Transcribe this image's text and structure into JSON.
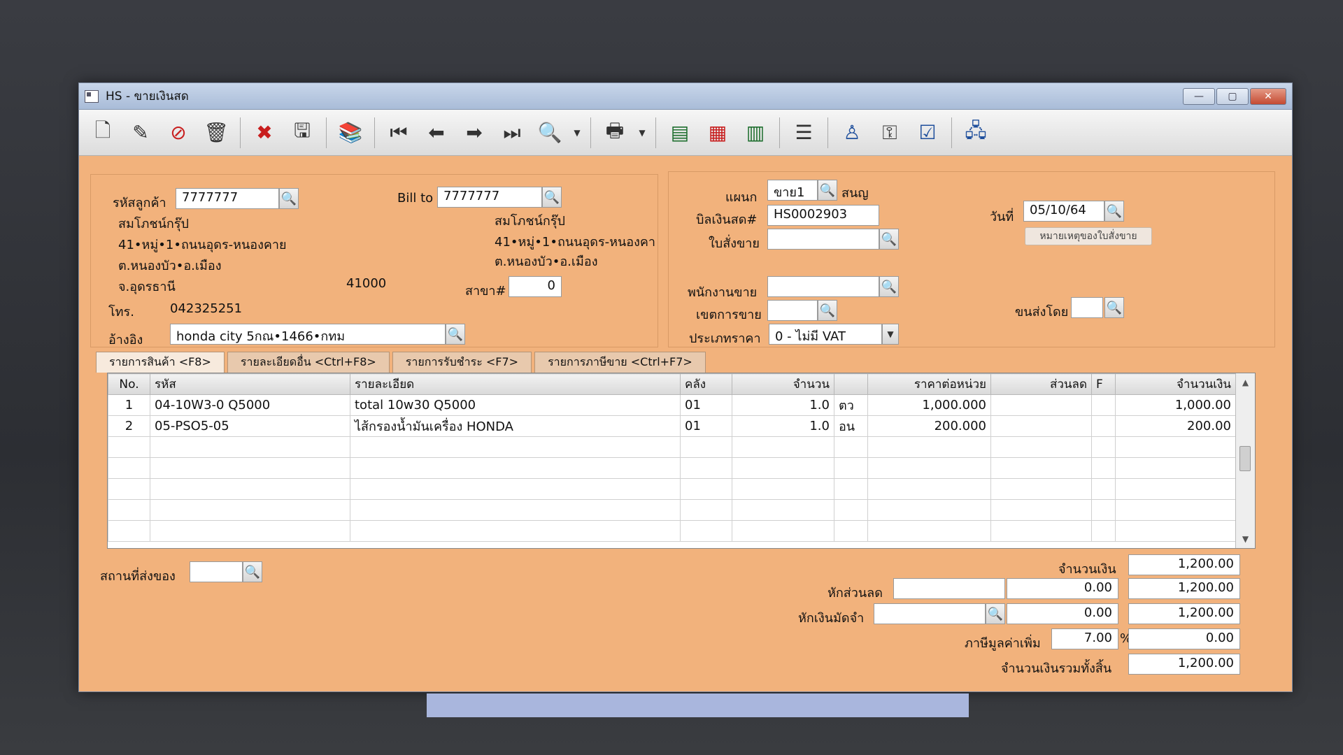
{
  "window": {
    "title": "HS - ขายเงินสด",
    "minimize": "—",
    "maximize": "▢",
    "close": "✕"
  },
  "toolbar": [
    {
      "name": "new-document-icon",
      "glyph": "🗋"
    },
    {
      "name": "edit-icon",
      "glyph": "✎"
    },
    {
      "name": "void-icon",
      "glyph": "⊘"
    },
    {
      "name": "trash-icon",
      "glyph": "🗑"
    },
    {
      "name": "cancel-icon",
      "glyph": "✖"
    },
    {
      "name": "save-icon",
      "glyph": "🖫"
    },
    {
      "name": "books-icon",
      "glyph": "📚"
    },
    {
      "name": "first-record-icon",
      "glyph": "⏮"
    },
    {
      "name": "prev-record-icon",
      "glyph": "⬅"
    },
    {
      "name": "next-record-icon",
      "glyph": "➡"
    },
    {
      "name": "last-record-icon",
      "glyph": "⏭"
    },
    {
      "name": "search-document-icon",
      "glyph": "🔍"
    },
    {
      "name": "print-icon",
      "glyph": "🖶"
    },
    {
      "name": "report-icon",
      "glyph": "▤"
    },
    {
      "name": "form-icon",
      "glyph": "▦"
    },
    {
      "name": "calculator-icon",
      "glyph": "▥"
    },
    {
      "name": "receipt-icon",
      "glyph": "☰"
    },
    {
      "name": "approve-user-icon",
      "glyph": "♙"
    },
    {
      "name": "approve-key-icon",
      "glyph": "⚿"
    },
    {
      "name": "approve-doc-icon",
      "glyph": "☑"
    },
    {
      "name": "network-icon",
      "glyph": "🖧"
    }
  ],
  "customer": {
    "code_label": "รหัสลูกค้า",
    "code": "7777777",
    "name": "สมโภชน์กรุ๊ป",
    "address1": "41•หมู่•1•ถนนอุดร-หนองคาย",
    "address2": "ต.หนองบัว•อ.เมือง",
    "province": "จ.อุดรธานี",
    "postcode": "41000",
    "phone_label": "โทร.",
    "phone": "042325251",
    "ref_label": "อ้างอิง",
    "ref": "honda city 5กณ•1466•กทม"
  },
  "bill_to": {
    "label": "Bill to",
    "code": "7777777",
    "name": "สมโภชน์กรุ๊ป",
    "address1": "41•หมู่•1•ถนนอุดร-หนองคา",
    "address2": "ต.หนองบัว•อ.เมือง",
    "branch_label": "สาขา#",
    "branch": "0"
  },
  "doc": {
    "dept_label": "แผนก",
    "dept": "ขาย1",
    "dept_name": "สนญ",
    "bill_label": "บิลเงินสด#",
    "bill_no": "HS0002903",
    "order_label": "ใบสั่งขาย",
    "order_no": "",
    "date_label": "วันที่",
    "date": "05/10/64",
    "note_button": "หมายเหตุของใบสั่งขาย",
    "salesman_label": "พนักงานขาย",
    "salesman": "",
    "area_label": "เขตการขาย",
    "area": "",
    "ship_label": "ขนส่งโดย",
    "ship": "",
    "price_type_label": "ประเภทราคา",
    "price_type": "0 - ไม่มี VAT"
  },
  "tabs": [
    {
      "label": "รายการสินค้า <F8>"
    },
    {
      "label": "รายละเอียดอื่น <Ctrl+F8>"
    },
    {
      "label": "รายการรับชำระ <F7>"
    },
    {
      "label": "รายการภาษีขาย <Ctrl+F7>"
    }
  ],
  "table": {
    "headers": {
      "no": "No.",
      "code": "รหัส",
      "desc": "รายละเอียด",
      "wh": "คลัง",
      "qty": "จำนวน",
      "unit": "",
      "price": "ราคาต่อหน่วย",
      "disc": "ส่วนลด",
      "f": "F",
      "amount": "จำนวนเงิน"
    },
    "rows": [
      {
        "no": "1",
        "code": "04-10W3-0 Q5000",
        "desc": "total 10w30 Q5000",
        "wh": "01",
        "qty": "1.0",
        "unit": "ตว",
        "price": "1,000.000",
        "disc": "",
        "f": "",
        "amount": "1,000.00"
      },
      {
        "no": "2",
        "code": "05-PSO5-05",
        "desc": "ไส้กรองน้ำมันเครื่อง HONDA",
        "wh": "01",
        "qty": "1.0",
        "unit": "อน",
        "price": "200.000",
        "disc": "",
        "f": "",
        "amount": "200.00"
      }
    ]
  },
  "footer": {
    "ship_place_label": "สถานที่ส่งของ",
    "ship_place": "",
    "amount_label": "จำนวนเงิน",
    "amount": "1,200.00",
    "discount_label": "หักส่วนลด",
    "discount_text": "",
    "discount_value": "0.00",
    "after_discount": "1,200.00",
    "deposit_label": "หักเงินมัดจำ",
    "deposit_text": "",
    "deposit_value": "0.00",
    "after_deposit": "1,200.00",
    "vat_label": "ภาษีมูลค่าเพิ่ม",
    "vat_rate": "7.00",
    "vat_pct": "%",
    "vat_amount": "0.00",
    "total_label": "จำนวนเงินรวมทั้งสิ้น",
    "total": "1,200.00"
  },
  "colors": {
    "form_bg": "#f2b27c",
    "title_bg": "#b7c7df",
    "taskbar": "#a9b6dd"
  }
}
